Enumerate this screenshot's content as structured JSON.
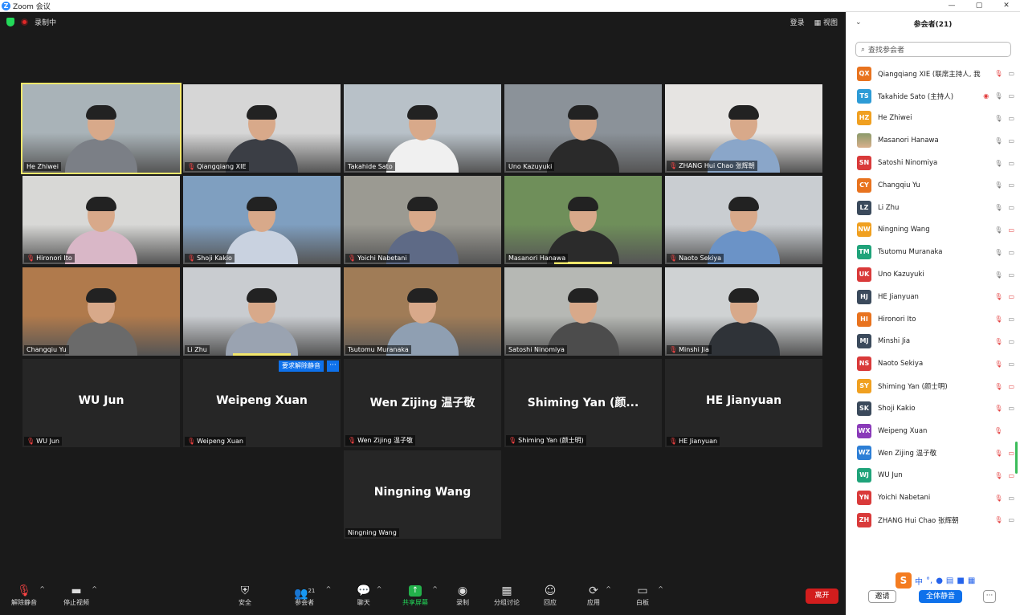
{
  "window": {
    "title": "Zoom 会议",
    "controls": [
      "—",
      "▢",
      "✕"
    ]
  },
  "status": {
    "recording_label": "录制中",
    "right_items": [
      "登录",
      "视图"
    ]
  },
  "tiles": [
    {
      "name": "He Zhiwei",
      "muted": false,
      "video": true,
      "highlight": true,
      "colors": {
        "bg": "#a9b3b8",
        "shirt": "#7b7f86"
      }
    },
    {
      "name": "Qiangqiang XIE",
      "muted": true,
      "video": true,
      "colors": {
        "bg": "#d6d6d6",
        "shirt": "#3b3e45"
      }
    },
    {
      "name": "Takahide Sato",
      "muted": false,
      "video": true,
      "colors": {
        "bg": "#b8c1c8",
        "shirt": "#f0f0f0"
      }
    },
    {
      "name": "Uno Kazuyuki",
      "muted": false,
      "video": true,
      "colors": {
        "bg": "#8b9299",
        "shirt": "#2a2a2a"
      }
    },
    {
      "name": "ZHANG Hui Chao 张辉朝",
      "muted": true,
      "video": true,
      "colors": {
        "bg": "#e6e4e2",
        "shirt": "#8aa6c9"
      }
    },
    {
      "name": "Hironori Ito",
      "muted": true,
      "video": true,
      "colors": {
        "bg": "#d8d8d6",
        "shirt": "#d9b7c7"
      }
    },
    {
      "name": "Shoji Kakio",
      "muted": true,
      "video": true,
      "colors": {
        "bg": "#7f9fc0",
        "shirt": "#c9d2e0"
      }
    },
    {
      "name": "Yoichi Nabetani",
      "muted": true,
      "video": true,
      "colors": {
        "bg": "#9b9a92",
        "shirt": "#5e6a86"
      }
    },
    {
      "name": "Masanori Hanawa",
      "muted": false,
      "video": true,
      "speaking": true,
      "colors": {
        "bg": "#6f8f5a",
        "shirt": "#2b2b2b"
      }
    },
    {
      "name": "Naoto Sekiya",
      "muted": true,
      "video": true,
      "colors": {
        "bg": "#c9cdd1",
        "shirt": "#6b93c7"
      }
    },
    {
      "name": "Changqiu Yu",
      "muted": false,
      "video": true,
      "colors": {
        "bg": "#b07a4c",
        "shirt": "#6a6a6a"
      }
    },
    {
      "name": "Li Zhu",
      "muted": false,
      "video": true,
      "speaking": true,
      "colors": {
        "bg": "#c9ccd0",
        "shirt": "#9aa3b1"
      }
    },
    {
      "name": "Tsutomu Muranaka",
      "muted": false,
      "video": true,
      "colors": {
        "bg": "#a07c57",
        "shirt": "#8f9fb2"
      }
    },
    {
      "name": "Satoshi Ninomiya",
      "muted": false,
      "video": true,
      "colors": {
        "bg": "#b6b8b4",
        "shirt": "#4c4c4c"
      }
    },
    {
      "name": "Minshi Jia",
      "muted": true,
      "video": true,
      "colors": {
        "bg": "#cfd2d3",
        "shirt": "#2f3338"
      }
    },
    {
      "name": "WU Jun",
      "muted": true,
      "video": false,
      "big": "WU Jun"
    },
    {
      "name": "Weipeng Xuan",
      "muted": true,
      "video": false,
      "big": "Weipeng Xuan"
    },
    {
      "name": "Wen Zijing 温子敬",
      "muted": true,
      "video": false,
      "big": "Wen  Zijing 温子敬"
    },
    {
      "name": "Shiming Yan (颜士明)",
      "muted": true,
      "video": false,
      "big": "Shiming Yan (颜..."
    },
    {
      "name": "HE Jianyuan",
      "muted": true,
      "video": false,
      "big": "HE Jianyuan"
    },
    {
      "name": "Ningning Wang",
      "muted": false,
      "video": false,
      "big": "Ningning Wang"
    }
  ],
  "ask_unmute": {
    "label": "要求解除静音",
    "more": "···"
  },
  "toolbar": {
    "unmute": "解除静音",
    "stop_video": "停止视频",
    "security": "安全",
    "participants": "参会者",
    "participants_count": "21",
    "chat": "聊天",
    "share": "共享屏幕",
    "record": "录制",
    "breakout": "分组讨论",
    "reactions": "回应",
    "apps": "应用",
    "whiteboard": "白板",
    "leave": "离开"
  },
  "panel": {
    "title": "参会者(21)",
    "search_placeholder": "查找参会者",
    "participants": [
      {
        "initials": "QX",
        "name": "Qiangqiang XIE (联席主持人, 我)",
        "color": "#e8731f",
        "mic": "off",
        "cam": "on"
      },
      {
        "initials": "TS",
        "name": "Takahide Sato (主持人)",
        "color": "#2d9bd6",
        "mic": "on",
        "cam": "on",
        "rec": true
      },
      {
        "initials": "HZ",
        "name": "He Zhiwei",
        "color": "#f0a020",
        "mic": "on",
        "cam": "on"
      },
      {
        "initials": "",
        "name": "Masanori Hanawa",
        "color": "#7a8b5a",
        "mic": "on",
        "cam": "on",
        "photo": true
      },
      {
        "initials": "SN",
        "name": "Satoshi Ninomiya",
        "color": "#d93a3a",
        "mic": "on",
        "cam": "on"
      },
      {
        "initials": "CY",
        "name": "Changqiu Yu",
        "color": "#e8731f",
        "mic": "on",
        "cam": "on"
      },
      {
        "initials": "LZ",
        "name": "Li Zhu",
        "color": "#3b4a5c",
        "mic": "on",
        "cam": "on"
      },
      {
        "initials": "NW",
        "name": "Ningning Wang",
        "color": "#f0a020",
        "mic": "on",
        "cam": "off"
      },
      {
        "initials": "TM",
        "name": "Tsutomu Muranaka",
        "color": "#1fa37a",
        "mic": "on",
        "cam": "on"
      },
      {
        "initials": "UK",
        "name": "Uno Kazuyuki",
        "color": "#d93a3a",
        "mic": "on",
        "cam": "on"
      },
      {
        "initials": "HJ",
        "name": "HE Jianyuan",
        "color": "#3b4a5c",
        "mic": "off",
        "cam": "off"
      },
      {
        "initials": "HI",
        "name": "Hironori Ito",
        "color": "#e8731f",
        "mic": "off",
        "cam": "on"
      },
      {
        "initials": "MJ",
        "name": "Minshi Jia",
        "color": "#3b4a5c",
        "mic": "off",
        "cam": "on"
      },
      {
        "initials": "NS",
        "name": "Naoto Sekiya",
        "color": "#d93a3a",
        "mic": "off",
        "cam": "on"
      },
      {
        "initials": "SY",
        "name": "Shiming Yan (颜士明)",
        "color": "#f0a020",
        "mic": "off",
        "cam": "off"
      },
      {
        "initials": "SK",
        "name": "Shoji Kakio",
        "color": "#3b4a5c",
        "mic": "off",
        "cam": "on"
      },
      {
        "initials": "WX",
        "name": "Weipeng Xuan",
        "color": "#8a3ab9",
        "mic": "off",
        "cam": "none"
      },
      {
        "initials": "WZ",
        "name": "Wen Zijing 温子敬",
        "color": "#2d7fd6",
        "mic": "off",
        "cam": "off"
      },
      {
        "initials": "WJ",
        "name": "WU Jun",
        "color": "#1fa37a",
        "mic": "off",
        "cam": "off"
      },
      {
        "initials": "YN",
        "name": "Yoichi Nabetani",
        "color": "#d93a3a",
        "mic": "off",
        "cam": "on"
      },
      {
        "initials": "ZH",
        "name": "ZHANG Hui Chao 张辉朝",
        "color": "#d93a3a",
        "mic": "off",
        "cam": "on"
      }
    ],
    "invite": "邀请",
    "mute_all": "全体静音",
    "more": "···"
  },
  "ime": {
    "logo": "S",
    "items": [
      "中",
      "°,",
      "🎤",
      "▦",
      "👕",
      "▦"
    ]
  }
}
